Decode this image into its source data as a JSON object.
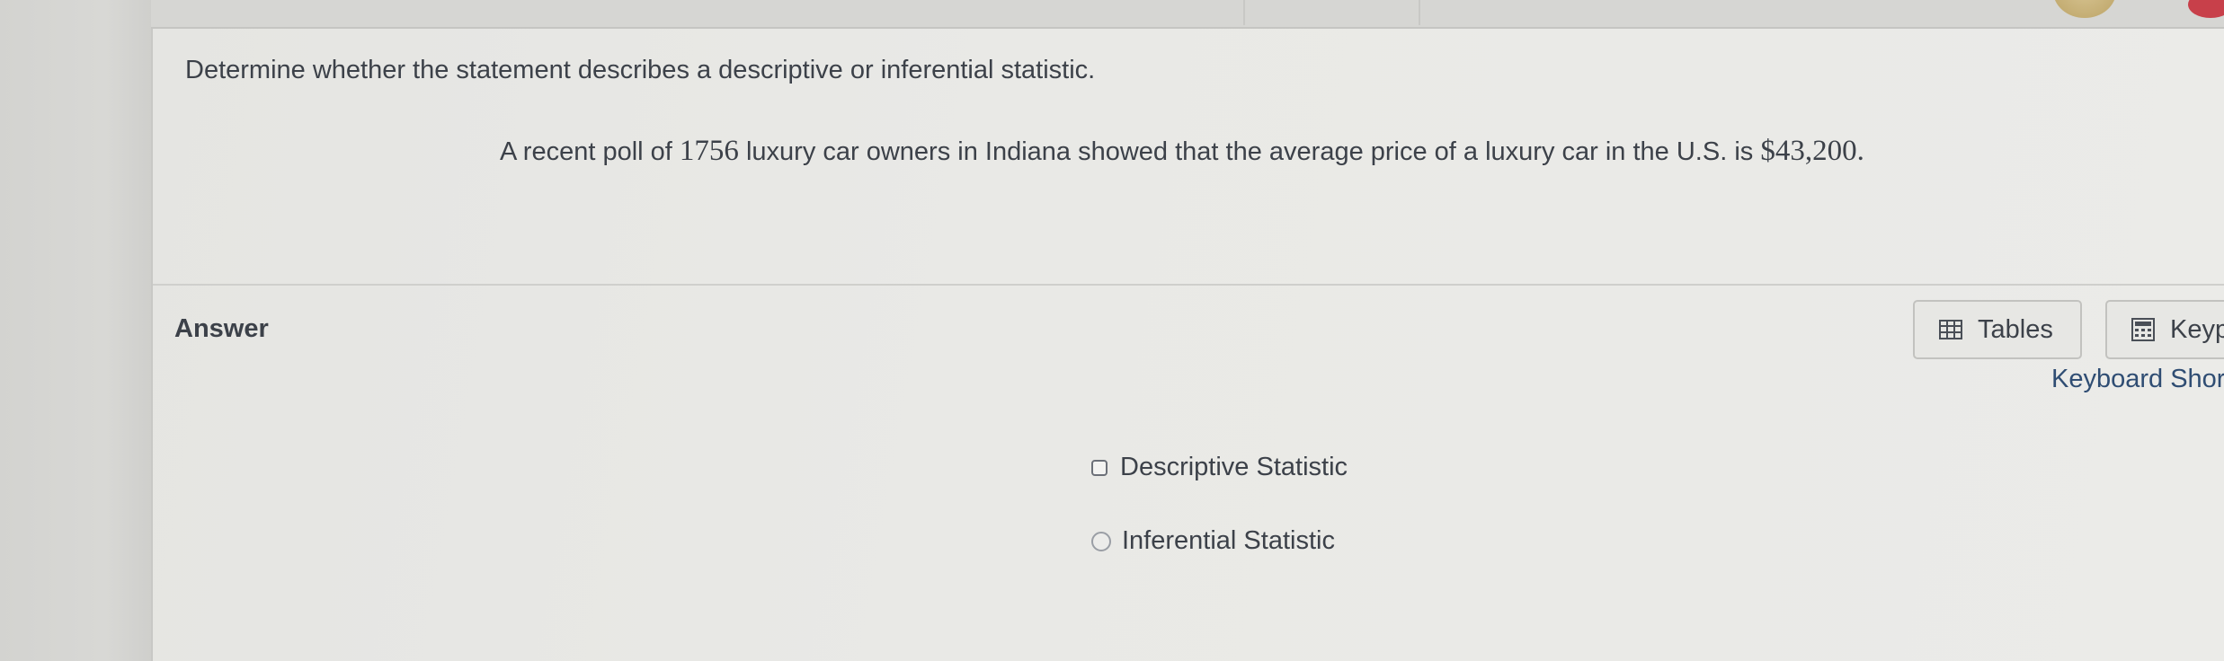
{
  "question": {
    "instruction": "Determine whether the statement describes a descriptive or inferential statistic.",
    "statement": {
      "part1": "A recent poll of ",
      "count": "1756",
      "part2": " luxury car owners in Indiana showed that the average price of a luxury car in the U.S. is ",
      "price": "$43,200",
      "part3": "."
    }
  },
  "answer": {
    "label": "Answer",
    "options": [
      {
        "label": "Descriptive Statistic",
        "control": "checkbox",
        "selected": false
      },
      {
        "label": "Inferential Statistic",
        "control": "radio",
        "selected": false
      }
    ]
  },
  "tools": {
    "tables_label": "Tables",
    "tables_icon": "table-grid-icon",
    "keypad_label": "Keypad",
    "keypad_icon": "keypad-icon",
    "keyboard_shortcuts_label": "Keyboard Shortcuts"
  },
  "colors": {
    "link": "#2f4d73",
    "text": "#3c4149",
    "panel": "#e9e9e6"
  }
}
